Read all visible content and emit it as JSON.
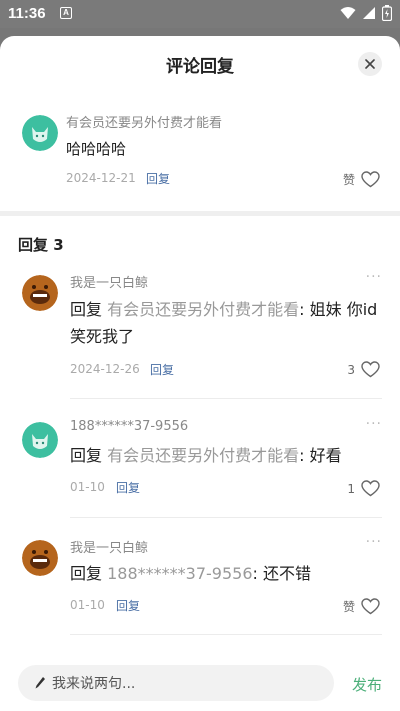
{
  "status": {
    "time": "11:36",
    "a_icon": "A"
  },
  "sheet": {
    "title": "评论回复"
  },
  "top_comment": {
    "user": "有会员还要另外付费才能看",
    "text": "哈哈哈哈",
    "date": "2024-12-21",
    "reply_label": "回复",
    "like_label": "赞"
  },
  "replies_header": "回复 3",
  "replies": [
    {
      "user": "我是一只白鲸",
      "prefix": "回复",
      "target": "有会员还要另外付费才能看",
      "content": ": 姐妹 你id笑死我了",
      "date": "2024-12-26",
      "reply_label": "回复",
      "likes": "3"
    },
    {
      "user": "188******37-9556",
      "prefix": "回复",
      "target": "有会员还要另外付费才能看",
      "content": ": 好看",
      "date": "01-10",
      "reply_label": "回复",
      "likes": "1"
    },
    {
      "user": "我是一只白鲸",
      "prefix": "回复",
      "target": "188******37-9556",
      "content": ": 还不错",
      "date": "01-10",
      "reply_label": "回复",
      "likes": "赞"
    }
  ],
  "input": {
    "placeholder": "我来说两句..."
  },
  "publish_label": "发布",
  "colors": {
    "link": "#4a6fa5",
    "publish": "#4caf7a",
    "avatar_green": "#3dbfa0",
    "avatar_brown": "#b5651d"
  }
}
